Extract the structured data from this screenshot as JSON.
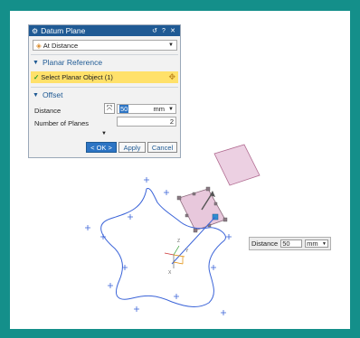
{
  "dialog": {
    "title": "Datum Plane",
    "type_dropdown": "At Distance",
    "planar_reference": {
      "header": "Planar Reference",
      "select_label": "Select Planar Object (1)"
    },
    "offset": {
      "header": "Offset",
      "distance_label": "Distance",
      "distance_value": "50",
      "distance_unit": "mm",
      "num_planes_label": "Number of Planes",
      "num_planes_value": "2"
    },
    "buttons": {
      "ok": "< OK >",
      "apply": "Apply",
      "cancel": "Cancel"
    }
  },
  "callout": {
    "label": "Distance",
    "value": "50",
    "unit": "mm"
  },
  "colors": {
    "frame": "#148f8a",
    "titlebar": "#1f5a94",
    "highlight": "#ffe16a",
    "curve": "#3a63d8",
    "plane_fill": "#e8c8dc",
    "plane_stroke": "#b06a90"
  }
}
